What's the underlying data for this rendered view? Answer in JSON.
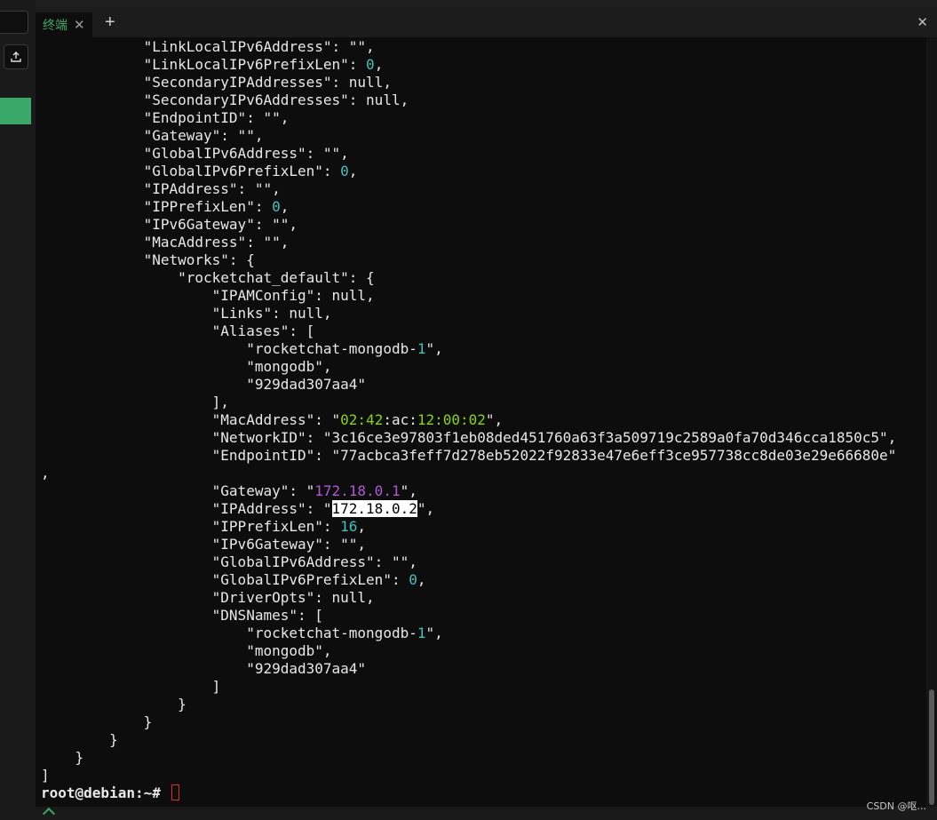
{
  "tab": {
    "label": "终端",
    "close_glyph": "✕"
  },
  "new_tab_glyph": "+",
  "close_panel_glyph": "✕",
  "terminal": {
    "lines": [
      [
        {
          "t": "            \"LinkLocalIPv6Address\": \"\","
        }
      ],
      [
        {
          "t": "            \"LinkLocalIPv6PrefixLen\": "
        },
        {
          "t": "0",
          "c": "num"
        },
        {
          "t": ","
        }
      ],
      [
        {
          "t": "            \"SecondaryIPAddresses\": null,"
        }
      ],
      [
        {
          "t": "            \"SecondaryIPv6Addresses\": null,"
        }
      ],
      [
        {
          "t": "            \"EndpointID\": \"\","
        }
      ],
      [
        {
          "t": "            \"Gateway\": \"\","
        }
      ],
      [
        {
          "t": "            \"GlobalIPv6Address\": \"\","
        }
      ],
      [
        {
          "t": "            \"GlobalIPv6PrefixLen\": "
        },
        {
          "t": "0",
          "c": "num"
        },
        {
          "t": ","
        }
      ],
      [
        {
          "t": "            \"IPAddress\": \"\","
        }
      ],
      [
        {
          "t": "            \"IPPrefixLen\": "
        },
        {
          "t": "0",
          "c": "num"
        },
        {
          "t": ","
        }
      ],
      [
        {
          "t": "            \"IPv6Gateway\": \"\","
        }
      ],
      [
        {
          "t": "            \"MacAddress\": \"\","
        }
      ],
      [
        {
          "t": "            \"Networks\": {"
        }
      ],
      [
        {
          "t": "                \"rocketchat_default\": {"
        }
      ],
      [
        {
          "t": "                    \"IPAMConfig\": null,"
        }
      ],
      [
        {
          "t": "                    \"Links\": null,"
        }
      ],
      [
        {
          "t": "                    \"Aliases\": ["
        }
      ],
      [
        {
          "t": "                        \"rocketchat-mongodb-"
        },
        {
          "t": "1",
          "c": "num"
        },
        {
          "t": "\","
        }
      ],
      [
        {
          "t": "                        \"mongodb\","
        }
      ],
      [
        {
          "t": "                        \"929dad307aa4\""
        }
      ],
      [
        {
          "t": "                    ],"
        }
      ],
      [
        {
          "t": "                    \"MacAddress\": \""
        },
        {
          "t": "02:42",
          "c": "grn"
        },
        {
          "t": ":ac:"
        },
        {
          "t": "12:00:02",
          "c": "grn"
        },
        {
          "t": "\","
        }
      ],
      [
        {
          "t": "                    \"NetworkID\": \"3c16ce3e97803f1eb08ded451760a63f3a509719c2589a0fa70d346cca1850c5\","
        }
      ],
      [
        {
          "t": "                    \"EndpointID\": \"77acbca3feff7d278eb52022f92833e47e6eff3ce957738cc8de03e29e66680e\""
        }
      ],
      [
        {
          "t": ","
        }
      ],
      [
        {
          "t": "                    \"Gateway\": \""
        },
        {
          "t": "172.18.0.1",
          "c": "pur"
        },
        {
          "t": "\","
        }
      ],
      [
        {
          "t": "                    \"IPAddress\": \""
        },
        {
          "t": "172.18.0.2",
          "c": "sel"
        },
        {
          "t": "\","
        }
      ],
      [
        {
          "t": "                    \"IPPrefixLen\": "
        },
        {
          "t": "16",
          "c": "num"
        },
        {
          "t": ","
        }
      ],
      [
        {
          "t": "                    \"IPv6Gateway\": \"\","
        }
      ],
      [
        {
          "t": "                    \"GlobalIPv6Address\": \"\","
        }
      ],
      [
        {
          "t": "                    \"GlobalIPv6PrefixLen\": "
        },
        {
          "t": "0",
          "c": "num"
        },
        {
          "t": ","
        }
      ],
      [
        {
          "t": "                    \"DriverOpts\": null,"
        }
      ],
      [
        {
          "t": "                    \"DNSNames\": ["
        }
      ],
      [
        {
          "t": "                        \"rocketchat-mongodb-"
        },
        {
          "t": "1",
          "c": "num"
        },
        {
          "t": "\","
        }
      ],
      [
        {
          "t": "                        \"mongodb\","
        }
      ],
      [
        {
          "t": "                        \"929dad307aa4\""
        }
      ],
      [
        {
          "t": "                    ]"
        }
      ],
      [
        {
          "t": "                }"
        }
      ],
      [
        {
          "t": "            }"
        }
      ],
      [
        {
          "t": "        }"
        }
      ],
      [
        {
          "t": "    }"
        }
      ],
      [
        {
          "t": "]"
        }
      ]
    ],
    "prompt": "root@debian:~# "
  },
  "watermark": "CSDN @呕...",
  "colors": {
    "accent": "#3aa868",
    "number": "#3ac4c0",
    "mac_hex": "#8bd600",
    "ip_purple": "#b356d6",
    "cursor": "#e0282d"
  },
  "icons": {
    "upload": "upload-icon",
    "status": "chevron-up-icon"
  }
}
